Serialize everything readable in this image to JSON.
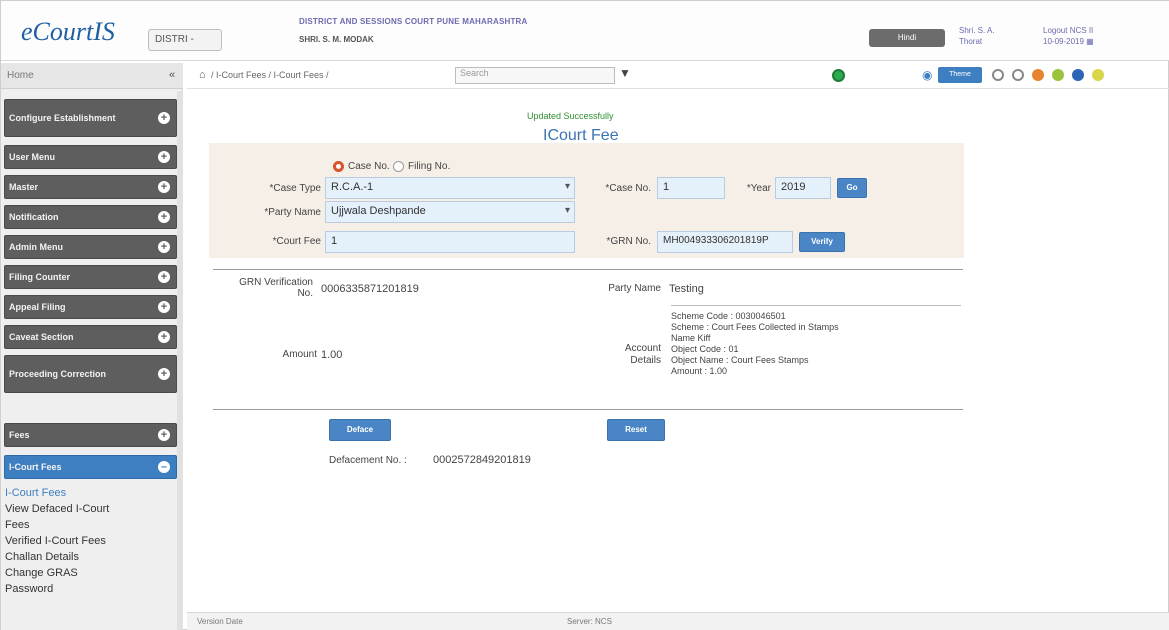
{
  "header": {
    "logo": "eCourtIS",
    "district_select": "DISTRI -",
    "court_name": "DISTRICT AND SESSIONS COURT PUNE MAHARASHTRA",
    "judge_name": "SHRI. S. M. MODAK",
    "action_button": "Hindi",
    "user_name": "Shri. S. A. Thorat",
    "logout": "Logout",
    "server": "NCS II",
    "date": "10-09-2019"
  },
  "sidebar": {
    "home_label": "Home",
    "collapse_icon": "double-left-arrow-icon",
    "menu": [
      {
        "label": "Configure Establishment"
      },
      {
        "label": "User Menu"
      },
      {
        "label": "Master"
      },
      {
        "label": "Notification"
      },
      {
        "label": "Admin Menu"
      },
      {
        "label": "Filing Counter"
      },
      {
        "label": "Appeal Filing"
      },
      {
        "label": "Caveat Section"
      },
      {
        "label": "Proceeding Correction"
      },
      {
        "label": "Fees"
      },
      {
        "label": "I-Court Fees"
      }
    ],
    "submenu": [
      {
        "label": "I-Court Fees"
      },
      {
        "label": "View Defaced I-Court"
      },
      {
        "label": "Fees"
      },
      {
        "label": "Verified I-Court Fees"
      },
      {
        "label": "Challan Details"
      },
      {
        "label": "Change GRAS"
      },
      {
        "label": "Password"
      }
    ]
  },
  "toolbar": {
    "breadcrumb": "/ I-Court Fees / I-Court Fees /",
    "search_placeholder": "Search",
    "theme_label": "Theme",
    "home_icon": "home-icon",
    "filter_icon": "filter-icon",
    "theme_colors": [
      "#ffffff",
      "#ffffff",
      "#e8842f",
      "#9bc33c",
      "#2f66b3",
      "#d8d64a"
    ]
  },
  "form": {
    "status": "Updated Successfully",
    "title": "ICourt Fee",
    "radio_case_no": "Case No.",
    "radio_filing_no": "Filing No.",
    "case_type_label": "*Case Type",
    "case_type_value": "R.C.A.-1",
    "case_no_label": "*Case No.",
    "case_no_value": "1",
    "year_label": "*Year",
    "year_value": "2019",
    "go_button": "Go",
    "party_name_label": "*Party Name",
    "party_name_value": "Ujjwala Deshpande",
    "court_fee_label": "*Court Fee",
    "court_fee_value": "1",
    "grn_no_label": "*GRN No.",
    "grn_no_value": "MH004933306201819P",
    "verify_button": "Verify"
  },
  "result": {
    "grn_verification_label": "GRN Verification No.",
    "grn_verification_value": "0006335871201819",
    "party_name_label": "Party Name",
    "party_name_value": "Testing",
    "amount_label": "Amount",
    "amount_value": "1.00",
    "account_details_label": "Account Details",
    "account": [
      "Scheme Code : 0030046501",
      "Scheme : Court Fees Collected in Stamps",
      "Name Kiff",
      "Object Code : 01",
      "Object Name : Court Fees Stamps",
      "Amount : 1.00"
    ],
    "deface_button": "Deface",
    "reset_button": "Reset",
    "defacement_label": "Defacement No. :",
    "defacement_value": "0002572849201819"
  },
  "footer": {
    "left": "Version Date",
    "mid": "Server: NCS"
  }
}
